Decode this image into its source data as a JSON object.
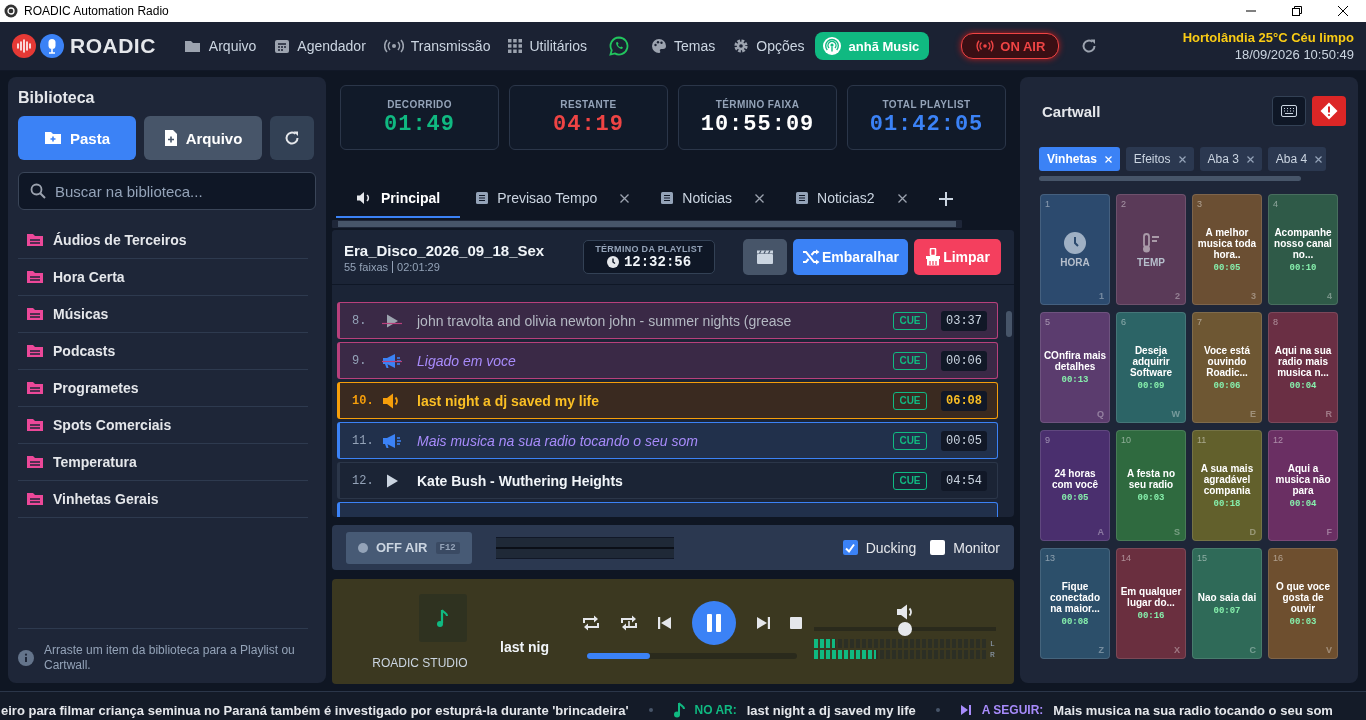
{
  "window": {
    "title": "ROADIC Automation Radio"
  },
  "header": {
    "brand": "ROADIC",
    "menu": [
      "Arquivo",
      "Agendador",
      "Transmissão",
      "Utilitários",
      "Temas",
      "Opções"
    ],
    "program_badge": "anhã Music",
    "on_air_button": "ON AIR",
    "weather": "Hortolândia 25°C Céu limpo",
    "datetime": "18/09/2026 10:50:49"
  },
  "library": {
    "title": "Biblioteca",
    "buttons": [
      "Pasta",
      "Arquivo"
    ],
    "search": {
      "placeholder": "Buscar na biblioteca..."
    },
    "folders": [
      "Áudios de Terceiros",
      "Hora Certa",
      "Músicas",
      "Podcasts",
      "Programetes",
      "Spots Comerciais",
      "Temperatura",
      "Vinhetas Gerais"
    ],
    "hint": "Arraste um item da biblioteca para a Playlist ou Cartwall."
  },
  "counters": [
    {
      "label": "DECORRIDO",
      "value": "01:49",
      "color": "#10b981"
    },
    {
      "label": "RESTANTE",
      "value": "04:19",
      "color": "#ef4444"
    },
    {
      "label": "TÉRMINO FAIXA",
      "value": "10:55:09",
      "color": "#ffffff"
    },
    {
      "label": "TOTAL PLAYLIST",
      "value": "01:42:05",
      "color": "#3b82f6"
    }
  ],
  "playlist_tabs": [
    {
      "label": "Principal",
      "selected": true,
      "closable": false
    },
    {
      "label": "Previsao Tempo",
      "selected": false,
      "closable": true
    },
    {
      "label": "Noticias",
      "selected": false,
      "closable": true
    },
    {
      "label": "Noticias2",
      "selected": false,
      "closable": true
    }
  ],
  "playlist": {
    "name": "Era_Disco_2026_09_18_Sex",
    "tracks": "55 faixas",
    "duration": "02:01:29",
    "end_label": "TÉRMINO DA PLAYLIST",
    "end_time": "12:32:56",
    "buttons": [
      "Embaralhar",
      "Limpar"
    ],
    "rows": [
      {
        "number": "8.",
        "kind": "music",
        "played": true,
        "playing": false,
        "title": "john travolta and olivia newton john - summer nights (grease",
        "cue": "CUE",
        "duration": "03:37"
      },
      {
        "number": "9.",
        "kind": "spot",
        "played": true,
        "playing": false,
        "title": "Ligado em voce",
        "cue": "CUE",
        "duration": "00:06"
      },
      {
        "number": "10.",
        "kind": "music",
        "played": false,
        "playing": true,
        "title": "last night a dj saved my life",
        "cue": "CUE",
        "duration": "06:08"
      },
      {
        "number": "11.",
        "kind": "spot",
        "played": false,
        "playing": false,
        "title": "Mais musica na sua radio tocando o seu som",
        "cue": "CUE",
        "duration": "00:05"
      },
      {
        "number": "12.",
        "kind": "music",
        "played": false,
        "playing": false,
        "title": "Kate Bush - Wuthering Heights",
        "cue": "CUE",
        "duration": "04:54"
      }
    ]
  },
  "air_bar": {
    "off_air": "OFF AIR",
    "shortcut": "F12",
    "options": [
      {
        "label": "Ducking",
        "checked": true
      },
      {
        "label": "Monitor",
        "checked": false
      }
    ]
  },
  "player": {
    "studio": "ROADIC STUDIO",
    "title": "last nig",
    "progress": {
      "level": 0.3
    },
    "volume": {
      "level": 0.5
    },
    "vu": [
      {
        "channel": "L",
        "level": 0.12
      },
      {
        "channel": "R",
        "level": 0.36
      }
    ]
  },
  "cartwall": {
    "title": "Cartwall",
    "tabs": [
      {
        "label": "Vinhetas",
        "selected": true
      },
      {
        "label": "Efeitos",
        "selected": false
      },
      {
        "label": "Aba 3",
        "selected": false
      },
      {
        "label": "Aba 4",
        "selected": false
      }
    ],
    "carts": [
      {
        "number": "1",
        "kind": "clock",
        "title": "HORA",
        "key": "1",
        "color": "#2c4a6e"
      },
      {
        "number": "2",
        "kind": "temp",
        "title": "TEMP",
        "key": "2",
        "color": "#5a3a58"
      },
      {
        "number": "3",
        "kind": "text",
        "title": "A melhor musica toda hora..",
        "duration": "00:05",
        "key": "3",
        "color": "#6b4f33"
      },
      {
        "number": "4",
        "kind": "text",
        "title": "Acompanhe nosso canal no...",
        "duration": "00:10",
        "key": "4",
        "color": "#2f5a48"
      },
      {
        "number": "5",
        "kind": "text",
        "title": "COnfira mais detalhes",
        "duration": "00:13",
        "key": "Q",
        "color": "#5b3c6e"
      },
      {
        "number": "6",
        "kind": "text",
        "title": "Deseja adquirir Software",
        "duration": "00:09",
        "key": "W",
        "color": "#2c6466"
      },
      {
        "number": "7",
        "kind": "text",
        "title": "Voce está ouvindo Roadic...",
        "duration": "00:06",
        "key": "E",
        "color": "#6e5733"
      },
      {
        "number": "8",
        "kind": "text",
        "title": "Aqui na sua radio mais musica n...",
        "duration": "00:04",
        "key": "R",
        "color": "#6a2f44"
      },
      {
        "number": "9",
        "kind": "text",
        "title": "24 horas com você",
        "duration": "00:05",
        "key": "A",
        "color": "#4a2f6e"
      },
      {
        "number": "10",
        "kind": "text",
        "title": "A festa no seu radio",
        "duration": "00:03",
        "key": "S",
        "color": "#2f6a3f"
      },
      {
        "number": "11",
        "kind": "text",
        "title": "A sua mais agradável compania",
        "duration": "00:18",
        "key": "D",
        "color": "#62602c"
      },
      {
        "number": "12",
        "kind": "text",
        "title": "Aqui a musica não para",
        "duration": "00:04",
        "key": "F",
        "color": "#6a2f63"
      },
      {
        "number": "13",
        "kind": "text",
        "title": "Fique conectado na maior...",
        "duration": "00:08",
        "key": "Z",
        "color": "#2c4f6a"
      },
      {
        "number": "14",
        "kind": "text",
        "title": "Em qualquer lugar do...",
        "duration": "00:16",
        "key": "X",
        "color": "#6a2f3f"
      },
      {
        "number": "15",
        "kind": "text",
        "title": "Nao saia dai",
        "duration": "00:07",
        "key": "C",
        "color": "#2f6a58"
      },
      {
        "number": "16",
        "kind": "text",
        "title": "O que voce gosta de ouvir",
        "duration": "00:03",
        "key": "V",
        "color": "#6e4f2f"
      }
    ]
  },
  "ticker": {
    "headline": "eiro para filmar criança seminua no Paraná também é investigado por estuprá-la durante 'brincadeira'",
    "now_label": "NO AR:",
    "now": "last night a dj saved my life",
    "next_label": "A SEGUIR:",
    "next": "Mais musica na sua radio tocando o seu som"
  }
}
